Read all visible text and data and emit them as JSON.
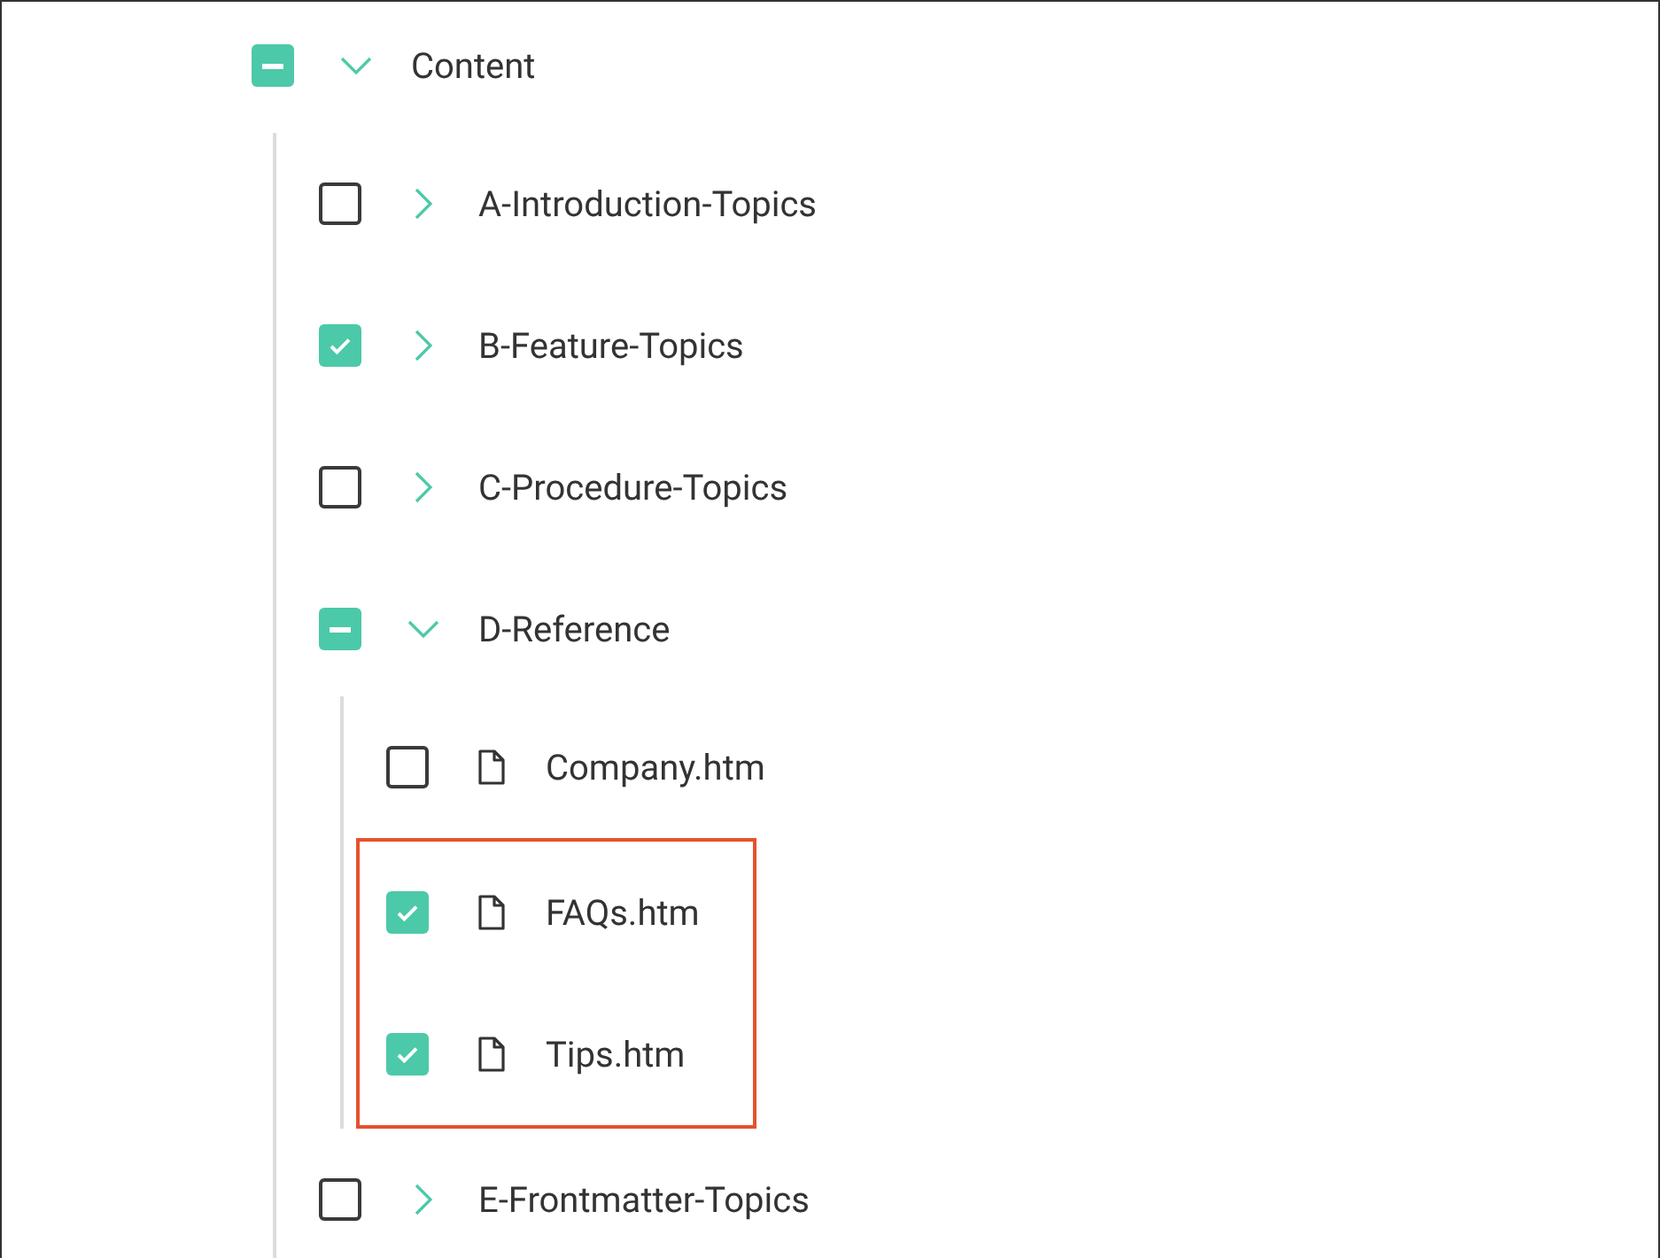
{
  "tree": [
    {
      "label": "Content",
      "kind": "folder",
      "indeterminate": true,
      "expanded": true,
      "children": [
        {
          "label": "A-Introduction-Topics",
          "kind": "folder",
          "checked": false,
          "expanded": false
        },
        {
          "label": "B-Feature-Topics",
          "kind": "folder",
          "checked": true,
          "expanded": false
        },
        {
          "label": "C-Procedure-Topics",
          "kind": "folder",
          "checked": false,
          "expanded": false
        },
        {
          "label": "D-Reference",
          "kind": "folder",
          "indeterminate": true,
          "expanded": true,
          "children": [
            {
              "label": "Company.htm",
              "kind": "file",
              "checked": false,
              "highlighted": false
            },
            {
              "label": "FAQs.htm",
              "kind": "file",
              "checked": true,
              "highlighted": true
            },
            {
              "label": "Tips.htm",
              "kind": "file",
              "checked": true,
              "highlighted": true
            }
          ]
        },
        {
          "label": "E-Frontmatter-Topics",
          "kind": "folder",
          "checked": false,
          "expanded": false
        }
      ]
    }
  ]
}
